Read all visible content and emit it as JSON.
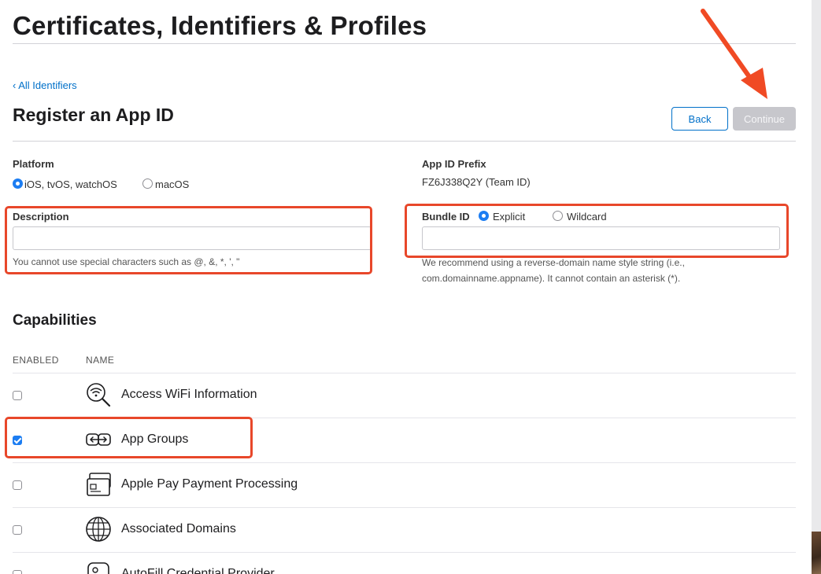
{
  "header": {
    "title": "Certificates, Identifiers & Profiles"
  },
  "nav": {
    "back_link": "‹ All Identifiers"
  },
  "page": {
    "subtitle": "Register an App ID",
    "back_button": "Back",
    "continue_button": "Continue"
  },
  "form": {
    "platform": {
      "label": "Platform",
      "options": [
        "iOS, tvOS, watchOS",
        "macOS"
      ],
      "selected": "iOS, tvOS, watchOS"
    },
    "app_id_prefix": {
      "label": "App ID Prefix",
      "value": "FZ6J338Q2Y (Team ID)"
    },
    "description": {
      "label": "Description",
      "value": "",
      "hint": "You cannot use special characters such as @, &, *, ', \""
    },
    "bundle_id": {
      "label": "Bundle ID",
      "options": [
        "Explicit",
        "Wildcard"
      ],
      "selected": "Explicit",
      "value": "",
      "hint_line1": "We recommend using a reverse-domain name style string (i.e.,",
      "hint_line2": "com.domainname.appname). It cannot contain an asterisk (*)."
    }
  },
  "capabilities": {
    "title": "Capabilities",
    "columns": {
      "enabled": "ENABLED",
      "name": "NAME"
    },
    "items": [
      {
        "name": "Access WiFi Information",
        "enabled": false,
        "icon": "wifi-search-icon"
      },
      {
        "name": "App Groups",
        "enabled": true,
        "icon": "app-groups-icon"
      },
      {
        "name": "Apple Pay Payment Processing",
        "enabled": false,
        "icon": "apple-pay-card-icon"
      },
      {
        "name": "Associated Domains",
        "enabled": false,
        "icon": "globe-icon"
      },
      {
        "name": "AutoFill Credential Provider",
        "enabled": false,
        "icon": "autofill-key-icon"
      }
    ]
  },
  "colors": {
    "accent": "#0070c9",
    "annotation": "#e8472a",
    "disabled_button": "#c7c7cc"
  }
}
